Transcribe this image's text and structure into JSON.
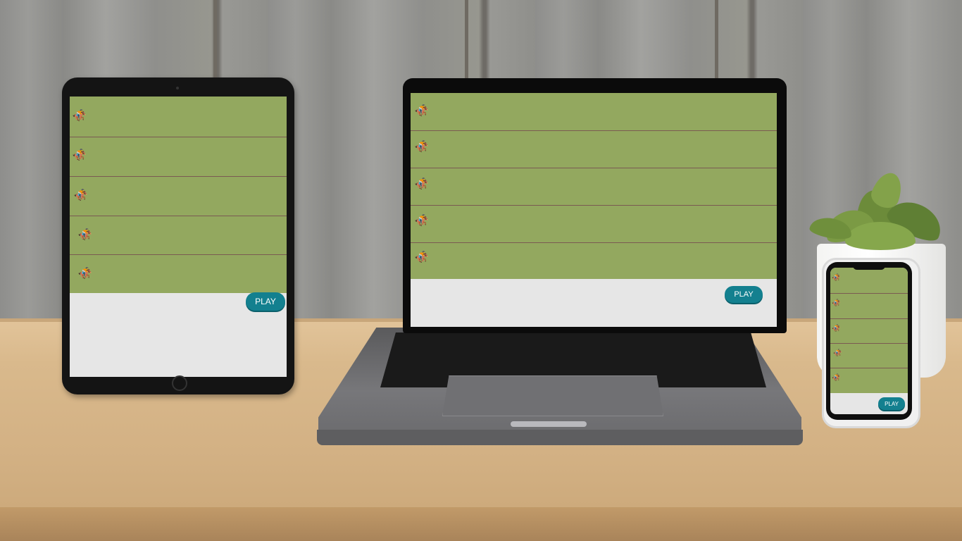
{
  "scene": {
    "devices": [
      "tablet",
      "laptop",
      "phone"
    ]
  },
  "game": {
    "play_label": "PLAY",
    "horse_icons": [
      "horse-racing-icon",
      "horse-racing-icon",
      "horse-racing-icon",
      "horse-racing-icon",
      "horse-racing-icon"
    ],
    "lane_count": 5
  },
  "colors": {
    "track": "#93a85f",
    "lane_divider": "#7a5a52",
    "play_button": "#13808f",
    "screen_bg": "#e6e6e6"
  }
}
